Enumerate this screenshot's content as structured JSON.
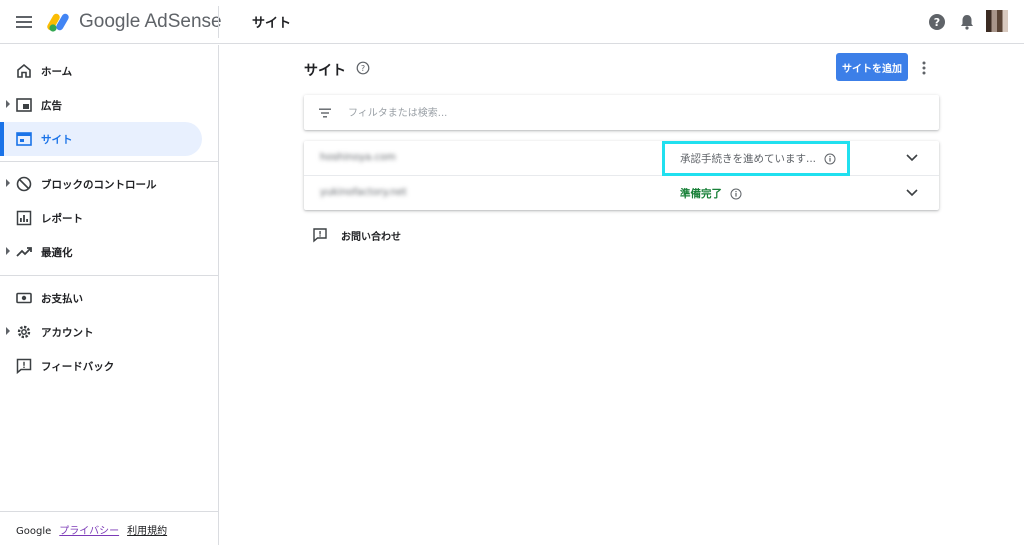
{
  "app": {
    "brand": "Google AdSense",
    "page_title": "サイト"
  },
  "sidebar": {
    "items": [
      {
        "label": "ホーム",
        "icon": "home-icon",
        "expandable": false,
        "active": false
      },
      {
        "label": "広告",
        "icon": "ads-icon",
        "expandable": true,
        "active": false
      },
      {
        "label": "サイト",
        "icon": "sites-icon",
        "expandable": false,
        "active": true
      },
      {
        "label": "ブロックのコントロール",
        "icon": "block-icon",
        "expandable": true,
        "active": false
      },
      {
        "label": "レポート",
        "icon": "reports-icon",
        "expandable": false,
        "active": false
      },
      {
        "label": "最適化",
        "icon": "trending-icon",
        "expandable": true,
        "active": false
      },
      {
        "label": "お支払い",
        "icon": "payments-icon",
        "expandable": false,
        "active": false
      },
      {
        "label": "アカウント",
        "icon": "gear-icon",
        "expandable": true,
        "active": false
      },
      {
        "label": "フィードバック",
        "icon": "feedback-icon",
        "expandable": false,
        "active": false
      }
    ],
    "footer": {
      "google": "Google",
      "privacy": "プライバシー",
      "terms": "利用規約"
    }
  },
  "main": {
    "title": "サイト",
    "add_button": "サイトを追加",
    "filter_placeholder": "フィルタまたは検索...",
    "sites": [
      {
        "domain": "hoshinoya.com",
        "status": "承認手続きを進めています...",
        "status_type": "pending"
      },
      {
        "domain": "yukinofactory.net",
        "status": "準備完了",
        "status_type": "ready"
      }
    ],
    "contact_label": "お問い合わせ"
  },
  "colors": {
    "accent": "#1a73e8",
    "button": "#3c7fe8",
    "ready": "#188038",
    "highlight": "#20e0ef"
  }
}
